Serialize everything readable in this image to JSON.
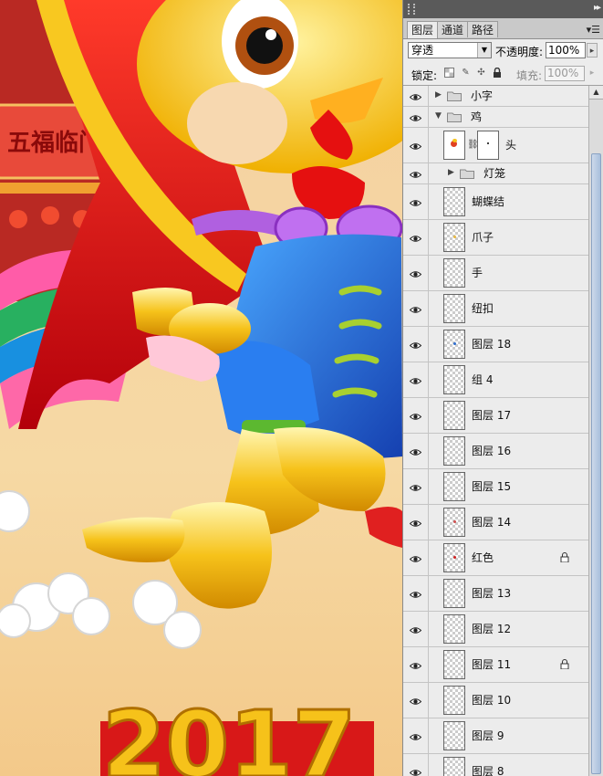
{
  "panel": {
    "tabs": [
      "图层",
      "通道",
      "路径"
    ],
    "blend_mode": "穿透",
    "opacity_label": "不透明度:",
    "opacity_value": "100%",
    "lock_label": "锁定:",
    "fill_label": "填充:",
    "fill_value": "100%"
  },
  "artwork": {
    "sign_text": "五福临门",
    "year_text": "2017"
  },
  "layers": [
    {
      "name": "小字",
      "kind": "group",
      "expanded": false,
      "indent": 0
    },
    {
      "name": "鸡",
      "kind": "group",
      "expanded": true,
      "indent": 0
    },
    {
      "name": "头",
      "kind": "masked",
      "indent": 1
    },
    {
      "name": "灯笼",
      "kind": "group",
      "expanded": false,
      "indent": 1
    },
    {
      "name": "蝴蝶结",
      "kind": "layer",
      "indent": 1
    },
    {
      "name": "爪子",
      "kind": "layer",
      "indent": 1,
      "dot": "#e8b840"
    },
    {
      "name": "手",
      "kind": "layer",
      "indent": 1
    },
    {
      "name": "纽扣",
      "kind": "layer",
      "indent": 1
    },
    {
      "name": "图层 18",
      "kind": "layer",
      "indent": 1,
      "dot": "#3070d0"
    },
    {
      "name": "组 4",
      "kind": "layer",
      "indent": 1
    },
    {
      "name": "图层 17",
      "kind": "layer",
      "indent": 1
    },
    {
      "name": "图层 16",
      "kind": "layer",
      "indent": 1
    },
    {
      "name": "图层 15",
      "kind": "layer",
      "indent": 1
    },
    {
      "name": "图层 14",
      "kind": "layer",
      "indent": 1,
      "dot": "#d05050"
    },
    {
      "name": "红色",
      "kind": "layer",
      "indent": 1,
      "dot": "#d02020",
      "locked": true
    },
    {
      "name": "图层 13",
      "kind": "layer",
      "indent": 1
    },
    {
      "name": "图层 12",
      "kind": "layer",
      "indent": 1
    },
    {
      "name": "图层 11",
      "kind": "layer",
      "indent": 1,
      "locked": true
    },
    {
      "name": "图层 10",
      "kind": "layer",
      "indent": 1
    },
    {
      "name": "图层 9",
      "kind": "layer",
      "indent": 1
    },
    {
      "name": "图层 8",
      "kind": "layer",
      "indent": 1
    }
  ]
}
